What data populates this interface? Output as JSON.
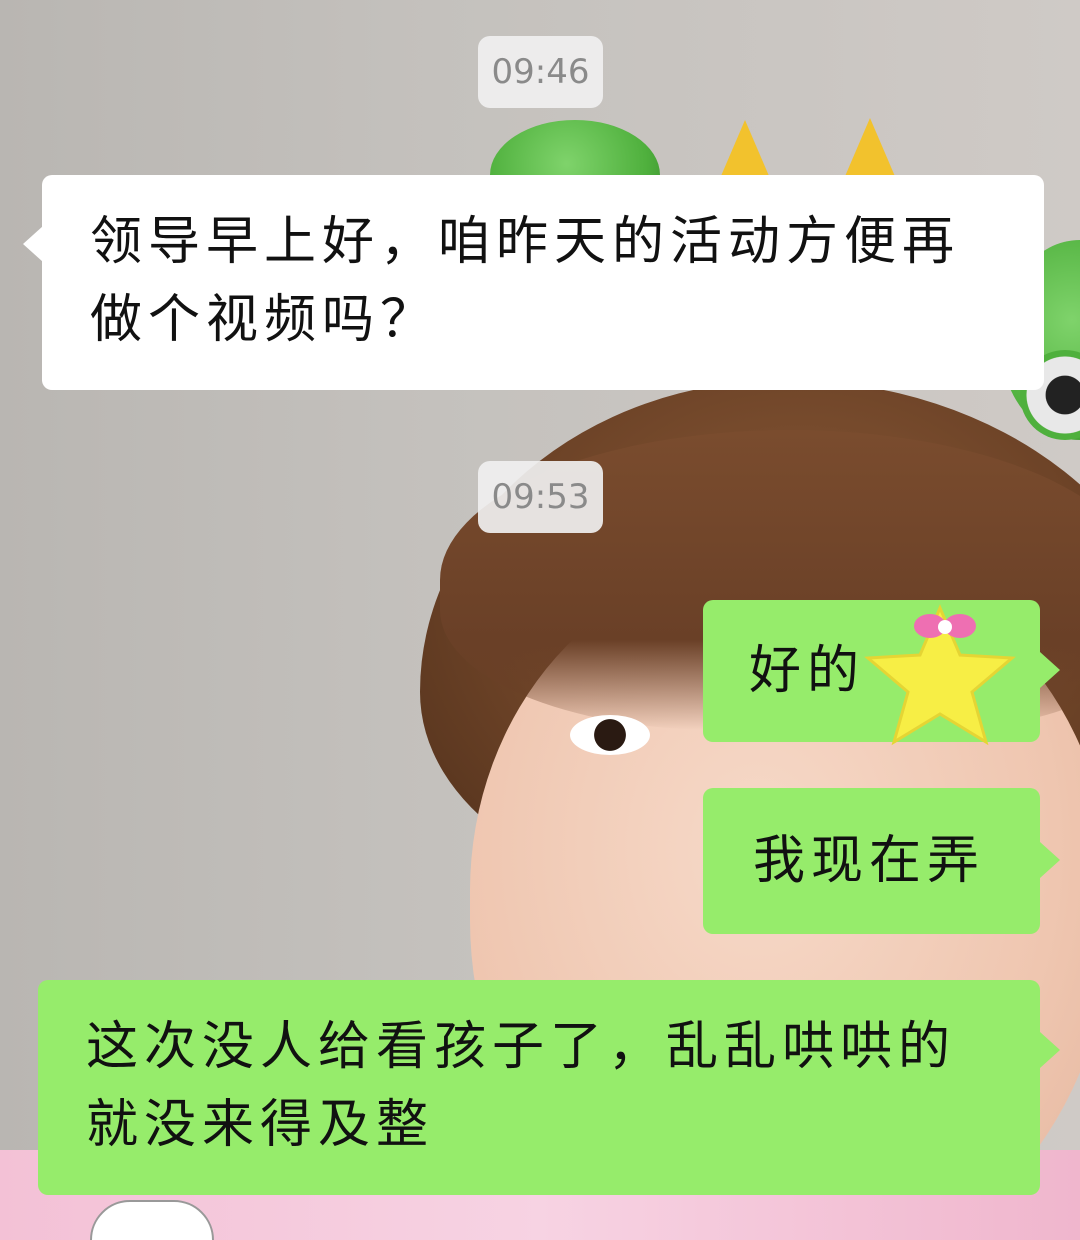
{
  "chat": {
    "timestamps": [
      "09:46",
      "09:53"
    ],
    "messages": [
      {
        "side": "left",
        "text": "领导早上好，咱昨天的活动方便再做个视频吗？"
      },
      {
        "side": "right",
        "text": "好的"
      },
      {
        "side": "right",
        "text": "我现在弄"
      },
      {
        "side": "right",
        "text": "这次没人给看孩子了，乱乱哄哄的就没来得及整"
      }
    ]
  },
  "colors": {
    "incoming_bubble": "#ffffff",
    "outgoing_bubble": "#96ec6b",
    "timestamp_text": "#8a8a8a"
  },
  "icons": [
    "star-sticker-icon",
    "cloud-sticker-icon"
  ]
}
